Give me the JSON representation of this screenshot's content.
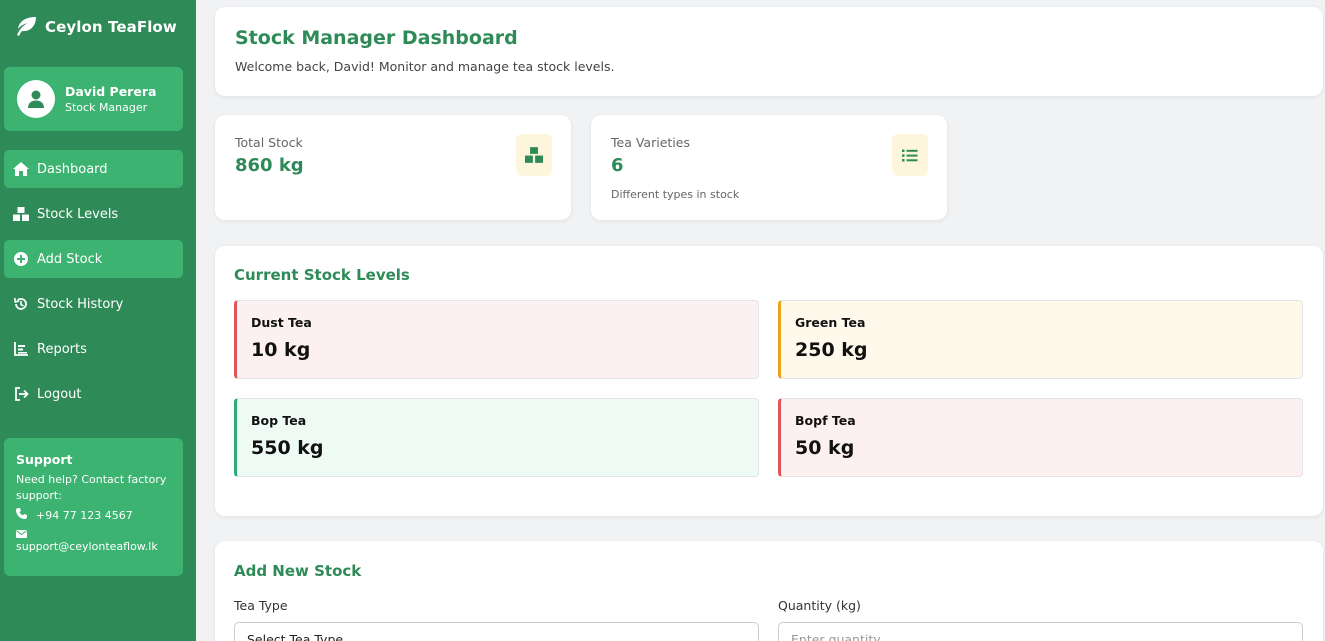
{
  "brand": {
    "name": "Ceylon TeaFlow",
    "icon": "leaf-icon"
  },
  "user": {
    "name": "David Perera",
    "role": "Stock Manager"
  },
  "nav": [
    {
      "label": "Dashboard",
      "icon": "home-icon",
      "active": true
    },
    {
      "label": "Stock Levels",
      "icon": "boxes-icon",
      "active": false
    },
    {
      "label": "Add Stock",
      "icon": "plus-circle-icon",
      "active": true
    },
    {
      "label": "Stock History",
      "icon": "history-icon",
      "active": false
    },
    {
      "label": "Reports",
      "icon": "chart-icon",
      "active": false
    },
    {
      "label": "Logout",
      "icon": "logout-icon",
      "active": false
    }
  ],
  "support": {
    "title": "Support",
    "text": "Need help? Contact factory support:",
    "phone": "+94 77 123 4567",
    "email": "support@ceylonteaflow.lk"
  },
  "header": {
    "title": "Stock Manager Dashboard",
    "welcome": "Welcome back, David! Monitor and manage tea stock levels."
  },
  "stats": [
    {
      "label": "Total Stock",
      "value": "860 kg",
      "sub": "",
      "icon": "boxes-icon"
    },
    {
      "label": "Tea Varieties",
      "value": "6",
      "sub": "Different types in stock",
      "icon": "list-icon"
    }
  ],
  "stock_levels": {
    "title": "Current Stock Levels",
    "items": [
      {
        "name": "Dust Tea",
        "qty": "10 kg",
        "status": "low"
      },
      {
        "name": "Green Tea",
        "qty": "250 kg",
        "status": "medium"
      },
      {
        "name": "Bop Tea",
        "qty": "550 kg",
        "status": "good"
      },
      {
        "name": "Bopf Tea",
        "qty": "50 kg",
        "status": "low"
      }
    ]
  },
  "add_stock": {
    "title": "Add New Stock",
    "tea_type_label": "Tea Type",
    "tea_type_value": "Select Tea Type",
    "quantity_label": "Quantity (kg)",
    "quantity_placeholder": "Enter quantity"
  },
  "colors": {
    "sidebar": "#2e8b57",
    "sidebar_active": "#3cb371",
    "accent": "#2e8b57",
    "low_bg": "#fdf0f0",
    "low_border": "#e05555",
    "medium_bg": "#fefaeb",
    "medium_border": "#f0a020",
    "good_bg": "#eefaf4",
    "good_border": "#2eaa78"
  }
}
